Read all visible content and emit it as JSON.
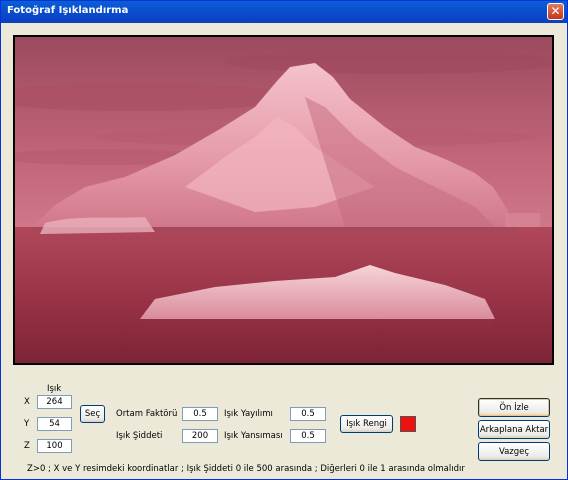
{
  "window": {
    "title": "Fotoğraf Işıklandırma",
    "close_label": "✕"
  },
  "controls": {
    "isik_label": "Işık",
    "x_label": "X",
    "x_value": "264",
    "y_label": "Y",
    "y_value": "54",
    "z_label": "Z",
    "z_value": "100",
    "sec_button": "Seç",
    "ortam_label": "Ortam Faktörü",
    "ortam_value": "0.5",
    "siddet_label": "Işık Şiddeti",
    "siddet_value": "200",
    "yayilim_label": "Işık Yayılımı",
    "yayilim_value": "0.5",
    "yansima_label": "Işık Yansıması",
    "yansima_value": "0.5",
    "renk_button": "Işık Rengi",
    "light_color": "#ee1111"
  },
  "buttons": {
    "preview": "Ön İzle",
    "apply_background": "Arkaplana Aktar",
    "cancel": "Vazgeç"
  },
  "hint": "Z>0  ; X ve Y resimdeki koordinatlar ; Işık Şiddeti 0 ile 500 arasında ; Diğerleri 0 ile 1 arasında olmalıdır"
}
